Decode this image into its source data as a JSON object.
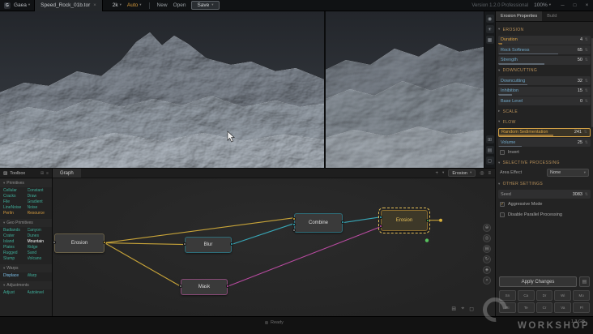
{
  "titlebar": {
    "app_name": "Gaea",
    "doc_tab": "Speed_Rock_01b.tor",
    "resolution": "2k",
    "auto": "Auto",
    "new": "New",
    "open": "Open",
    "save": "Save",
    "version": "Version 1.2.0 Professional",
    "zoom": "100%"
  },
  "icons": {
    "caret": "▾",
    "caret_right": "▸",
    "tab_close": "×",
    "win_min": "─",
    "win_max": "□",
    "win_close": "×",
    "plus": "+",
    "menu": "≡",
    "target": "◎",
    "check": "✓",
    "stepper": "⇅",
    "tool": "▨",
    "grid": "⊞",
    "list": "▤"
  },
  "view_rail": {
    "top": [
      "◉",
      "☀",
      "▦"
    ],
    "bottom": [
      "⊞",
      "▤",
      "◻"
    ]
  },
  "toolbox": {
    "title": "Toolbox",
    "categories": [
      {
        "name": "Primitives",
        "items": [
          "Cellular",
          "Constant",
          "Cracks",
          "Draw",
          "File",
          "Gradient",
          "LineNoise",
          "Noise",
          "Perlin",
          "Resource"
        ]
      },
      {
        "name": "Geo Primitives",
        "items": [
          "Badlands",
          "Canyon",
          "Crater",
          "Dunes",
          "Island",
          "Mountain",
          "Plates",
          "Ridge",
          "Rugged",
          "Sand",
          "Slump",
          "Volcano"
        ]
      },
      {
        "name": "Warps",
        "items": [
          "Displace",
          "Warp"
        ]
      },
      {
        "name": "Adjustments",
        "items": [
          "Adjust",
          "Autolevel"
        ]
      }
    ]
  },
  "graph": {
    "tab": "Graph",
    "breadcrumb": "Erosion",
    "nodes": [
      "Erosion",
      "Blur",
      "Mask",
      "Combine",
      "Erosion"
    ],
    "tools": [
      "⊕",
      "◎",
      "▤",
      "↻",
      "◈",
      "×"
    ],
    "corner": [
      "⊞",
      "⌖",
      "◻"
    ]
  },
  "props": {
    "tab_main": "Erosion Properties",
    "tab_secondary": "Build",
    "sections": {
      "erosion": {
        "title": "EROSION",
        "rows": [
          {
            "label": "Duration",
            "value": "4",
            "fill": 4
          },
          {
            "label": "Rock Softness",
            "value": "65",
            "fill": 65
          },
          {
            "label": "Strength",
            "value": "50",
            "fill": 50
          }
        ]
      },
      "downcutting": {
        "title": "DOWNCUTTING",
        "rows": [
          {
            "label": "Downcutting",
            "value": "32",
            "fill": 32
          },
          {
            "label": "Inhibition",
            "value": "15",
            "fill": 15
          },
          {
            "label": "Base Level",
            "value": "0",
            "fill": 0
          }
        ]
      },
      "scale": {
        "title": "SCALE"
      },
      "flow": {
        "title": "FLOW",
        "rows": [
          {
            "label": "Random Sedimentation",
            "value": "241",
            "fill": 60
          },
          {
            "label": "Volume",
            "value": "25",
            "fill": 25
          }
        ],
        "invert_label": "Invert"
      },
      "selective": {
        "title": "SELECTIVE PROCESSING",
        "area_label": "Area Effect",
        "area_value": "None"
      },
      "other": {
        "title": "OTHER SETTINGS",
        "seed_label": "Seed",
        "seed_value": "3083",
        "aggressive_label": "Aggressive Mode",
        "parallel_label": "Disable Parallel Processing"
      }
    },
    "apply": "Apply Changes",
    "presets": [
      [
        "Sn",
        "Ca",
        "Dr",
        "Wi",
        "Mo"
      ],
      [
        "Ri",
        "Te",
        "Cr",
        "Va",
        "Pl"
      ]
    ]
  },
  "statusbar": {
    "text": "Ready",
    "memory": "1.3 GB"
  },
  "watermark": {
    "text": "WORKSHOP"
  }
}
